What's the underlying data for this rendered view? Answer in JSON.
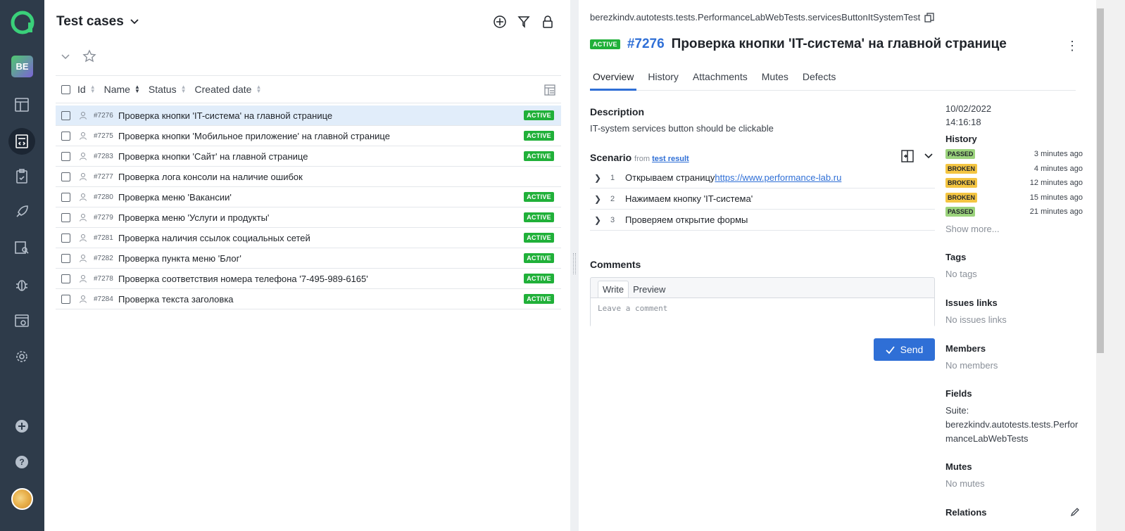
{
  "sidebar": {
    "user_initials": "BE",
    "items": [
      {
        "icon": "dashboard-icon"
      },
      {
        "icon": "test-cases-icon",
        "active": true
      },
      {
        "icon": "test-plans-icon"
      },
      {
        "icon": "launches-icon"
      },
      {
        "icon": "analytics-icon"
      },
      {
        "icon": "defects-icon"
      },
      {
        "icon": "jobs-icon"
      },
      {
        "icon": "settings-icon"
      }
    ]
  },
  "left": {
    "title": "Test cases",
    "columns": {
      "id": "Id",
      "name": "Name",
      "status": "Status",
      "created": "Created date"
    },
    "rows": [
      {
        "id": "#7276",
        "name": "Проверка кнопки 'IT-система' на главной странице",
        "status": "ACTIVE",
        "selected": true
      },
      {
        "id": "#7275",
        "name": "Проверка кнопки 'Мобильное приложение' на главной странице",
        "status": "ACTIVE"
      },
      {
        "id": "#7283",
        "name": "Проверка кнопки 'Сайт' на главной странице",
        "status": "ACTIVE"
      },
      {
        "id": "#7277",
        "name": "Проверка лога консоли на наличие ошибок",
        "status": ""
      },
      {
        "id": "#7280",
        "name": "Проверка меню 'Вакансии'",
        "status": "ACTIVE"
      },
      {
        "id": "#7279",
        "name": "Проверка меню 'Услуги и продукты'",
        "status": "ACTIVE"
      },
      {
        "id": "#7281",
        "name": "Проверка наличия ссылок социальных сетей",
        "status": "ACTIVE"
      },
      {
        "id": "#7282",
        "name": "Проверка пункта меню 'Блог'",
        "status": "ACTIVE"
      },
      {
        "id": "#7278",
        "name": "Проверка соответствия номера телефона '7-495-989-6165'",
        "status": "ACTIVE"
      },
      {
        "id": "#7284",
        "name": "Проверка текста заголовка",
        "status": "ACTIVE"
      }
    ]
  },
  "detail": {
    "path": "berezkindv.autotests.tests.PerformanceLabWebTests.servicesButtonItSystemTest",
    "status": "ACTIVE",
    "number": "#7276",
    "title": "Проверка кнопки 'IT-система' на главной странице",
    "tabs": [
      "Overview",
      "History",
      "Attachments",
      "Mutes",
      "Defects"
    ],
    "description_label": "Description",
    "description": "IT-system services button should be clickable",
    "scenario_label": "Scenario",
    "scenario_from": "from",
    "scenario_source": "test result",
    "steps": [
      {
        "n": "1",
        "text": "Открываем страницу ",
        "link": "https://www.performance-lab.ru"
      },
      {
        "n": "2",
        "text": "Нажимаем кнопку 'IT-система'",
        "link": ""
      },
      {
        "n": "3",
        "text": "Проверяем открытие формы",
        "link": ""
      }
    ],
    "comments_label": "Comments",
    "comment_tabs": {
      "write": "Write",
      "preview": "Preview"
    },
    "comment_placeholder": "Leave a comment",
    "send_label": "Send"
  },
  "side": {
    "date": "10/02/2022",
    "time": "14:16:18",
    "history_label": "History",
    "history": [
      {
        "status": "PASSED",
        "kind": "passed",
        "when": "3 minutes ago"
      },
      {
        "status": "BROKEN",
        "kind": "broken",
        "when": "4 minutes ago"
      },
      {
        "status": "BROKEN",
        "kind": "broken",
        "when": "12 minutes ago"
      },
      {
        "status": "BROKEN",
        "kind": "broken",
        "when": "15 minutes ago"
      },
      {
        "status": "PASSED",
        "kind": "passed",
        "when": "21 minutes ago"
      }
    ],
    "show_more": "Show more...",
    "tags_label": "Tags",
    "tags_value": "No tags",
    "issues_label": "Issues links",
    "issues_value": "No issues links",
    "members_label": "Members",
    "members_value": "No members",
    "fields_label": "Fields",
    "fields_value_1": "Suite:",
    "fields_value_2": "berezkindv.autotests.tests.PerformanceLabWebTests",
    "mutes_label": "Mutes",
    "mutes_value": "No mutes",
    "relations_label": "Relations"
  },
  "colors": {
    "accent": "#2f6fd6",
    "active_badge": "#20b039",
    "sidebar": "#2e3b4a",
    "passed": "#9bd37c",
    "broken": "#f4c542"
  }
}
